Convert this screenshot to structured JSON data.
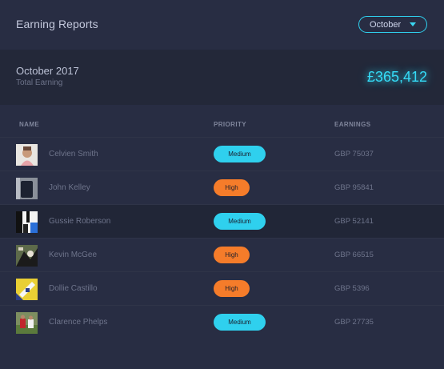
{
  "header": {
    "title": "Earning Reports",
    "month_select": {
      "value": "October"
    }
  },
  "summary": {
    "period": "October 2017",
    "label": "Total Earning",
    "amount": "£365,412"
  },
  "table": {
    "columns": [
      "NAME",
      "PRIORITY",
      "EARNINGS"
    ],
    "rows": [
      {
        "name": "Celvien Smith",
        "priority": "Medium",
        "earnings": "GBP 75037"
      },
      {
        "name": "John Kelley",
        "priority": "High",
        "earnings": "GBP 95841"
      },
      {
        "name": "Gussie Roberson",
        "priority": "Medium",
        "earnings": "GBP 52141"
      },
      {
        "name": "Kevin McGee",
        "priority": "High",
        "earnings": "GBP 66515"
      },
      {
        "name": "Dollie Castillo",
        "priority": "High",
        "earnings": "GBP 5396"
      },
      {
        "name": "Clarence Phelps",
        "priority": "Medium",
        "earnings": "GBP 27735"
      }
    ]
  },
  "colors": {
    "background": "#282d43",
    "accent": "#2fd0ee",
    "medium_badge": "#2fd0ee",
    "high_badge": "#f57c2a"
  }
}
